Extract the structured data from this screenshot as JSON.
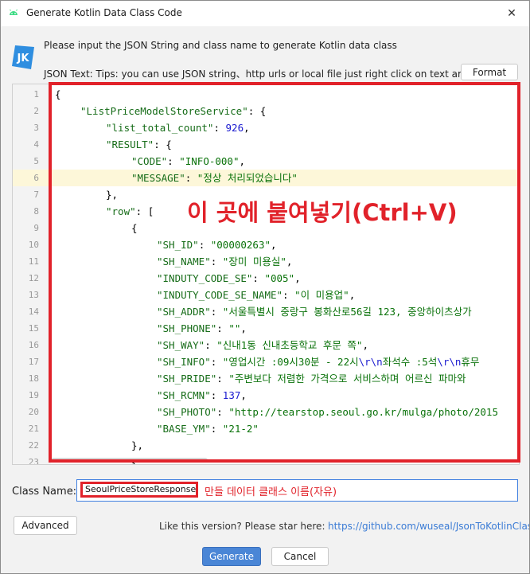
{
  "window": {
    "title": "Generate Kotlin Data Class Code",
    "close_glyph": "✕"
  },
  "logo": {
    "text": "JK"
  },
  "intro_text": "Please input the JSON String and class name to generate Kotlin data class",
  "json_label": "JSON Text: Tips: you can use JSON string、http urls or local file just right click on text area",
  "format_button": "Format",
  "editor": {
    "highlighted_line": 6,
    "lines": [
      {
        "n": "1",
        "indent": 0,
        "parts": [
          {
            "t": "{",
            "c": "p"
          }
        ]
      },
      {
        "n": "2",
        "indent": 1,
        "parts": [
          {
            "t": "\"ListPriceModelStoreService\"",
            "c": "key"
          },
          {
            "t": ": {",
            "c": "p"
          }
        ]
      },
      {
        "n": "3",
        "indent": 2,
        "parts": [
          {
            "t": "\"list_total_count\"",
            "c": "key"
          },
          {
            "t": ": ",
            "c": "p"
          },
          {
            "t": "926",
            "c": "num"
          },
          {
            "t": ",",
            "c": "p"
          }
        ]
      },
      {
        "n": "4",
        "indent": 2,
        "parts": [
          {
            "t": "\"RESULT\"",
            "c": "key"
          },
          {
            "t": ": {",
            "c": "p"
          }
        ]
      },
      {
        "n": "5",
        "indent": 3,
        "parts": [
          {
            "t": "\"CODE\"",
            "c": "key"
          },
          {
            "t": ": ",
            "c": "p"
          },
          {
            "t": "\"INFO-000\"",
            "c": "str"
          },
          {
            "t": ",",
            "c": "p"
          }
        ]
      },
      {
        "n": "6",
        "indent": 3,
        "parts": [
          {
            "t": "\"MESSAGE\"",
            "c": "key"
          },
          {
            "t": ": ",
            "c": "p"
          },
          {
            "t": "\"정상 처리되었습니다\"",
            "c": "str"
          }
        ]
      },
      {
        "n": "7",
        "indent": 2,
        "parts": [
          {
            "t": "},",
            "c": "p"
          }
        ]
      },
      {
        "n": "8",
        "indent": 2,
        "parts": [
          {
            "t": "\"row\"",
            "c": "key"
          },
          {
            "t": ": [",
            "c": "p"
          }
        ]
      },
      {
        "n": "9",
        "indent": 3,
        "parts": [
          {
            "t": "{",
            "c": "p"
          }
        ]
      },
      {
        "n": "10",
        "indent": 4,
        "parts": [
          {
            "t": "\"SH_ID\"",
            "c": "key"
          },
          {
            "t": ": ",
            "c": "p"
          },
          {
            "t": "\"00000263\"",
            "c": "str"
          },
          {
            "t": ",",
            "c": "p"
          }
        ]
      },
      {
        "n": "11",
        "indent": 4,
        "parts": [
          {
            "t": "\"SH_NAME\"",
            "c": "key"
          },
          {
            "t": ": ",
            "c": "p"
          },
          {
            "t": "\"장미 미용실\"",
            "c": "str"
          },
          {
            "t": ",",
            "c": "p"
          }
        ]
      },
      {
        "n": "12",
        "indent": 4,
        "parts": [
          {
            "t": "\"INDUTY_CODE_SE\"",
            "c": "key"
          },
          {
            "t": ": ",
            "c": "p"
          },
          {
            "t": "\"005\"",
            "c": "str"
          },
          {
            "t": ",",
            "c": "p"
          }
        ]
      },
      {
        "n": "13",
        "indent": 4,
        "parts": [
          {
            "t": "\"INDUTY_CODE_SE_NAME\"",
            "c": "key"
          },
          {
            "t": ": ",
            "c": "p"
          },
          {
            "t": "\"이 미용업\"",
            "c": "str"
          },
          {
            "t": ",",
            "c": "p"
          }
        ]
      },
      {
        "n": "14",
        "indent": 4,
        "parts": [
          {
            "t": "\"SH_ADDR\"",
            "c": "key"
          },
          {
            "t": ": ",
            "c": "p"
          },
          {
            "t": "\"서울특별시 중랑구 봉화산로56길 123, 중앙하이츠상가",
            "c": "str"
          }
        ]
      },
      {
        "n": "15",
        "indent": 4,
        "parts": [
          {
            "t": "\"SH_PHONE\"",
            "c": "key"
          },
          {
            "t": ": ",
            "c": "p"
          },
          {
            "t": "\"\"",
            "c": "str"
          },
          {
            "t": ",",
            "c": "p"
          }
        ]
      },
      {
        "n": "16",
        "indent": 4,
        "parts": [
          {
            "t": "\"SH_WAY\"",
            "c": "key"
          },
          {
            "t": ": ",
            "c": "p"
          },
          {
            "t": "\"신내1동 신내초등학교 후문 쪽\"",
            "c": "str"
          },
          {
            "t": ",",
            "c": "p"
          }
        ]
      },
      {
        "n": "17",
        "indent": 4,
        "parts": [
          {
            "t": "\"SH_INFO\"",
            "c": "key"
          },
          {
            "t": ": ",
            "c": "p"
          },
          {
            "t": "\"영업시간 :09시30분 - 22시",
            "c": "str"
          },
          {
            "t": "\\r\\n",
            "c": "num"
          },
          {
            "t": "좌석수 :5석",
            "c": "str"
          },
          {
            "t": "\\r\\n",
            "c": "num"
          },
          {
            "t": "휴무",
            "c": "str"
          }
        ]
      },
      {
        "n": "18",
        "indent": 4,
        "parts": [
          {
            "t": "\"SH_PRIDE\"",
            "c": "key"
          },
          {
            "t": ": ",
            "c": "p"
          },
          {
            "t": "\"주변보다 저렴한 가격으로 서비스하며 어르신 파마와",
            "c": "str"
          }
        ]
      },
      {
        "n": "19",
        "indent": 4,
        "parts": [
          {
            "t": "\"SH_RCMN\"",
            "c": "key"
          },
          {
            "t": ": ",
            "c": "p"
          },
          {
            "t": "137",
            "c": "num"
          },
          {
            "t": ",",
            "c": "p"
          }
        ]
      },
      {
        "n": "20",
        "indent": 4,
        "parts": [
          {
            "t": "\"SH_PHOTO\"",
            "c": "key"
          },
          {
            "t": ": ",
            "c": "p"
          },
          {
            "t": "\"http://tearstop.seoul.go.kr/mulga/photo/2015",
            "c": "str"
          }
        ]
      },
      {
        "n": "21",
        "indent": 4,
        "parts": [
          {
            "t": "\"BASE_YM\"",
            "c": "key"
          },
          {
            "t": ": ",
            "c": "p"
          },
          {
            "t": "\"21-2\"",
            "c": "str"
          }
        ]
      },
      {
        "n": "22",
        "indent": 3,
        "parts": [
          {
            "t": "},",
            "c": "p"
          }
        ]
      },
      {
        "n": "23",
        "indent": 3,
        "parts": [
          {
            "t": "{",
            "c": "p"
          }
        ]
      }
    ]
  },
  "annotation_paste": "이 곳에 붙여넣기(Ctrl+V)",
  "class_name": {
    "label": "Class Name:",
    "value": "SeoulPriceStoreResponse",
    "annotation": "만들 데이터 클래스 이름(자유)"
  },
  "advanced_button": "Advanced",
  "star_text": "Like this version? Please star here:",
  "star_link": "https://github.com/wuseal/JsonToKotlinClass",
  "generate_button": "Generate",
  "cancel_button": "Cancel",
  "colors": {
    "accent": "#4a86d6",
    "annotation": "#e1222a",
    "key": "#166c18",
    "number": "#1a1acf"
  }
}
